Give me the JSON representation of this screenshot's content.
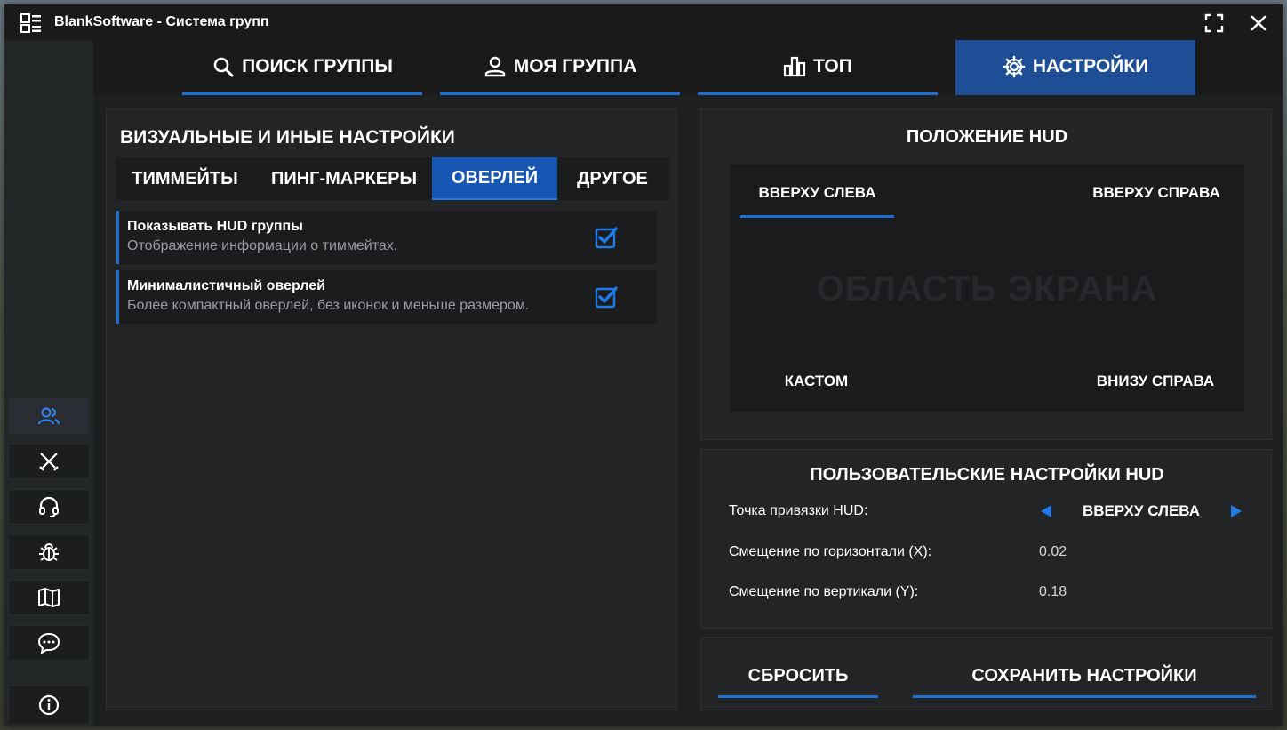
{
  "window": {
    "title": "BlankSoftware - Система групп"
  },
  "tabs": [
    {
      "label": "ПОИСК ГРУППЫ",
      "icon": "search-icon"
    },
    {
      "label": "МОЯ ГРУППА",
      "icon": "user-icon"
    },
    {
      "label": "ТОП",
      "icon": "bar-chart-icon"
    },
    {
      "label": "НАСТРОЙКИ",
      "icon": "gear-icon",
      "active": true
    }
  ],
  "sidebar": {
    "items": [
      {
        "icon": "users-icon",
        "active": true
      },
      {
        "icon": "crossed-swords-icon"
      },
      {
        "icon": "headset-icon"
      },
      {
        "icon": "bug-icon"
      },
      {
        "icon": "map-icon"
      },
      {
        "icon": "chat-icon"
      },
      {
        "icon": "info-icon"
      }
    ]
  },
  "visual": {
    "title": "ВИЗУАЛЬНЫЕ И ИНЫЕ НАСТРОЙКИ",
    "subtabs": [
      {
        "label": "ТИММЕЙТЫ"
      },
      {
        "label": "ПИНГ-МАРКЕРЫ"
      },
      {
        "label": "ОВЕРЛЕЙ",
        "active": true
      },
      {
        "label": "ДРУГОЕ"
      }
    ],
    "settings": [
      {
        "title": "Показывать HUD группы",
        "description": "Отображение информации о тиммейтах.",
        "checked": true
      },
      {
        "title": "Минималистичный оверлей",
        "description": "Более компактный оверлей, без иконок и меньше размером.",
        "checked": true
      }
    ]
  },
  "hud_position": {
    "title": "ПОЛОЖЕНИЕ HUD",
    "area_label": "ОБЛАСТЬ ЭКРАНА",
    "top_left": "ВВЕРХУ СЛЕВА",
    "top_right": "ВВЕРХУ СПРАВА",
    "custom": "КАСТОМ",
    "bottom_right": "ВНИЗУ СПРАВА",
    "selected": "top_left"
  },
  "custom_hud": {
    "title": "ПОЛЬЗОВАТЕЛЬСКИЕ НАСТРОЙКИ HUD",
    "anchor_label": "Точка привязки HUD:",
    "anchor_value": "ВВЕРХУ СЛЕВА",
    "offset_x_label": "Смещение по горизонтали (X):",
    "offset_x_value": "0.02",
    "offset_y_label": "Смещение по вертикали (Y):",
    "offset_y_value": "0.18"
  },
  "actions": {
    "reset_label": "СБРОСИТЬ",
    "save_label": "СОХРАНИТЬ НАСТРОЙКИ"
  },
  "colors": {
    "accent": "#1f6fd1",
    "active_tab": "#1e4f96",
    "panel": "#232426"
  }
}
